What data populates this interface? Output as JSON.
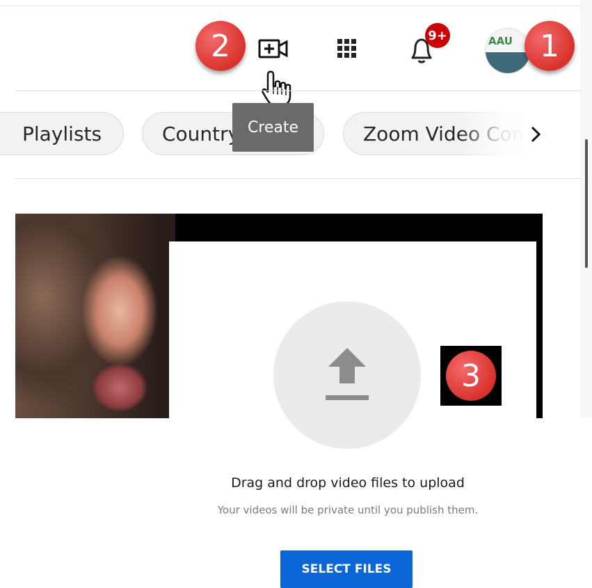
{
  "header": {
    "create_tooltip": "Create",
    "notification_count": "9+",
    "avatar_text": "AAU"
  },
  "markers": {
    "one": "1",
    "two": "2",
    "three": "3"
  },
  "chips": [
    {
      "label": "Playlists"
    },
    {
      "label": "Country Music"
    },
    {
      "label": "Zoom Video Communi"
    }
  ],
  "upload": {
    "primary_text": "Drag and drop video files to upload",
    "secondary_text": "Your videos will be private until you publish them.",
    "select_button": "SELECT FILES"
  },
  "colors": {
    "marker_red": "#d9322d",
    "notification_badge": "#cc0000",
    "select_button": "#0a66d6",
    "tooltip_bg": "#6a6a6a"
  },
  "icons": [
    "create-video-icon",
    "apps-grid-icon",
    "notification-bell-icon",
    "chevron-right-icon",
    "upload-arrow-icon",
    "cursor-hand-icon"
  ]
}
